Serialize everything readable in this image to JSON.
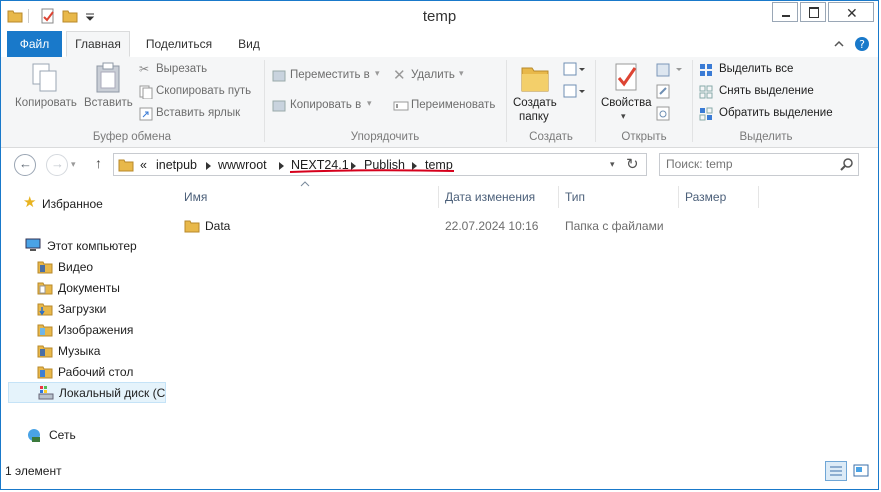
{
  "window": {
    "title": "temp"
  },
  "tabs": {
    "file": "Файл",
    "home": "Главная",
    "share": "Поделиться",
    "view": "Вид"
  },
  "ribbon": {
    "clipboard": {
      "label": "Буфер обмена",
      "copy": "Копировать",
      "paste": "Вставить",
      "cut": "Вырезать",
      "copy_path": "Скопировать путь",
      "paste_shortcut": "Вставить ярлык"
    },
    "organize": {
      "label": "Упорядочить",
      "move_to": "Переместить в",
      "copy_to": "Копировать в",
      "delete": "Удалить",
      "rename": "Переименовать"
    },
    "create": {
      "label": "Создать",
      "new_folder_line1": "Создать",
      "new_folder_line2": "папку"
    },
    "open": {
      "label": "Открыть",
      "properties": "Свойства"
    },
    "select": {
      "label": "Выделить",
      "select_all": "Выделить все",
      "select_none": "Снять выделение",
      "invert": "Обратить выделение"
    }
  },
  "address": {
    "prefix": "«",
    "crumbs": [
      "inetpub",
      "wwwroot",
      "NEXT24.1",
      "Publish",
      "temp"
    ]
  },
  "search": {
    "placeholder": "Поиск: temp"
  },
  "nav": {
    "favorites": "Избранное",
    "computer": "Этот компьютер",
    "items": [
      "Видео",
      "Документы",
      "Загрузки",
      "Изображения",
      "Музыка",
      "Рабочий стол",
      "Локальный диск (C"
    ],
    "network": "Сеть"
  },
  "columns": {
    "name": "Имя",
    "modified": "Дата изменения",
    "type": "Тип",
    "size": "Размер"
  },
  "files": [
    {
      "name": "Data",
      "modified": "22.07.2024 10:16",
      "type": "Папка с файлами",
      "size": ""
    }
  ],
  "status": {
    "count": "1 элемент"
  },
  "colors": {
    "accent": "#1979ca",
    "annotation": "#d6001c",
    "folder": "#e8b84a"
  }
}
